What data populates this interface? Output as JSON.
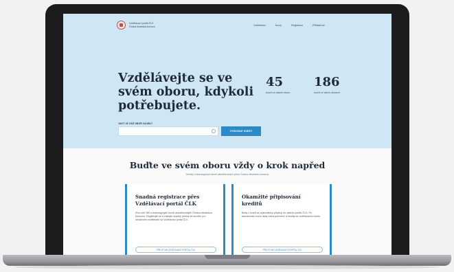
{
  "header": {
    "logo_line1": "Vzdělávací portál ČLK",
    "logo_line2": "Česká lékařská komora",
    "nav": [
      "Vzdělávání",
      "Kurzy",
      "Registrace",
      "Přihlásit se"
    ]
  },
  "hero": {
    "title": "Vzdělávejte se ve svém oboru, kdykoli potřebujete.",
    "stats": [
      {
        "number": "45",
        "label": "kurzů ve vašem oboru"
      },
      {
        "number": "186",
        "label": "kurzů ve všech oborech"
      }
    ],
    "search_label": "JAKÝ JE VÁŠ OBOR ZÁJMU?",
    "search_value": "",
    "search_button": "VYHLEDAT KURZY"
  },
  "section": {
    "title": "Buďte ve svém oboru vždy o krok napřed",
    "subtitle": "Desítky e-learningových kurzů akreditovaných přímo Českou lékařskou komorou"
  },
  "cards": [
    {
      "title": "Snadná registrace přes Vzdělávací portál ČLK",
      "text": "Více než 180 e-learningových kurzů akreditovaných Českou lékařskou komorou. Registrujte se a získejte snadný přístup ke kurzům pro celoživotní vzdělávání na Vzdělávací portál ČLK.",
      "link": "PŘEJÍT NA VZDĚLÁVACÍ PORTÁL ČLK"
    },
    {
      "title": "Okamžité připisování kreditů",
      "text": "Body z kurzů se automaticky připisují do vašeho profilu ČLK. Po absolvování kurzu lékař získá potvrzení a kredity do vzdělávacího kontu.",
      "link": "PŘEJÍT NA VZDĚLÁVACÍ PORTÁL ČLK"
    }
  ],
  "colors": {
    "hero_bg": "#cfe7f4",
    "accent": "#2e8ac2",
    "heading": "#1f2a3a"
  }
}
